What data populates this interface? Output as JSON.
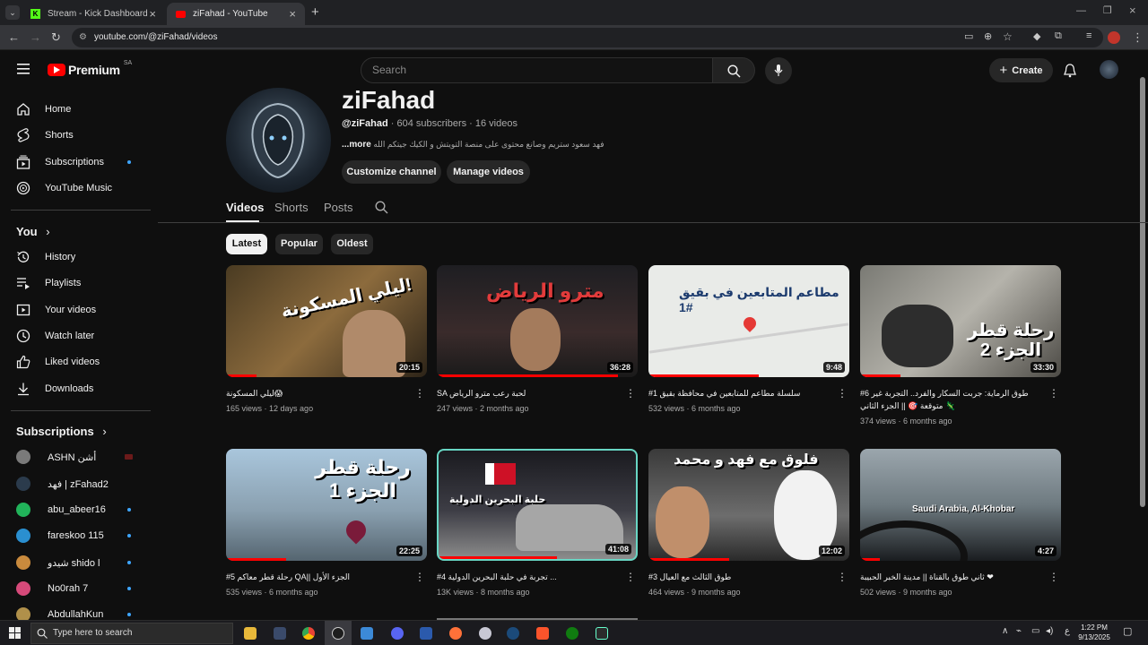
{
  "browser": {
    "tabs": [
      {
        "label": "Stream - Kick Dashboard"
      },
      {
        "label": "ziFahad - YouTube"
      }
    ],
    "url": "youtube.com/@ziFahad/videos"
  },
  "header": {
    "logo": "Premium",
    "region": "SA",
    "search_placeholder": "Search",
    "create_label": "Create"
  },
  "sidebar": {
    "main": [
      {
        "label": "Home"
      },
      {
        "label": "Shorts"
      },
      {
        "label": "Subscriptions"
      },
      {
        "label": "YouTube Music"
      }
    ],
    "you_title": "You",
    "you": [
      {
        "label": "History"
      },
      {
        "label": "Playlists"
      },
      {
        "label": "Your videos"
      },
      {
        "label": "Watch later"
      },
      {
        "label": "Liked videos"
      },
      {
        "label": "Downloads"
      }
    ],
    "subs_title": "Subscriptions",
    "subs": [
      {
        "label": "ASHN أشن",
        "color": "#7a7a7a"
      },
      {
        "label": "فهد | zFahad2",
        "color": "#2b3b4c"
      },
      {
        "label": "abu_abeer16",
        "color": "#21b35a"
      },
      {
        "label": "fareskoo 115",
        "color": "#2a8fd0"
      },
      {
        "label": "شيدو shido l",
        "color": "#c98a3d"
      },
      {
        "label": "No0rah 7",
        "color": "#d64a7a"
      },
      {
        "label": "AbdullahKun",
        "color": "#b0904a"
      }
    ]
  },
  "channel": {
    "name": "ziFahad",
    "handle": "@ziFahad",
    "meta": "· 604 subscribers · 16 videos",
    "description": "فهد سعود ستريم وصانع محتوى على منصة التويتش و الكيك جيتكم الله",
    "more": "...more",
    "customize": "Customize channel",
    "manage": "Manage videos",
    "tabs": [
      "Videos",
      "Shorts",
      "Posts"
    ],
    "chips": [
      "Latest",
      "Popular",
      "Oldest"
    ]
  },
  "videos": [
    {
      "title": "ليلي المسكونة😱",
      "views": "165 views",
      "age": "12 days ago",
      "duration": "20:15",
      "thumb_text": "ليلي المسكونة!",
      "progress": 0.15
    },
    {
      "title": "SA لحبة رعب مترو الرياض",
      "views": "247 views",
      "age": "2 months ago",
      "duration": "36:28",
      "thumb_text": "مترو الرياض",
      "progress": 0.9
    },
    {
      "title": "#1 سلسلة مطاعم للمتابعين في محافظة بقيق",
      "views": "532 views",
      "age": "6 months ago",
      "duration": "9:48",
      "thumb_text": "مطاعم المتابعين في بقيق #1",
      "progress": 0.55
    },
    {
      "title": "#6 طوق الرماية: جربت السكار والفرد.. التجربة غير متوقعة 🎯 || الجزء الثاني 🦎",
      "views": "374 views",
      "age": "6 months ago",
      "duration": "33:30",
      "thumb_text": "رحلة قطر الجزء 2",
      "progress": 0.2
    },
    {
      "title": "#5 رحلة قطر معاكم QA|| الجزء الأول",
      "views": "535 views",
      "age": "6 months ago",
      "duration": "22:25",
      "thumb_text": "رحلة قطر الجزء 1",
      "progress": 0.3
    },
    {
      "title": "#4 تجربة في حلبة البحرين الدولية ...",
      "views": "13K views",
      "age": "8 months ago",
      "duration": "41:08",
      "thumb_text": "حلبة البحرين الدولية",
      "progress": 0.6
    },
    {
      "title": "#3 طوق الثالث مع العيال",
      "views": "464 views",
      "age": "9 months ago",
      "duration": "12:02",
      "thumb_text": "فلوق مع فهد و محمد",
      "progress": 0.4
    },
    {
      "title": "ثاني طوق بالقناة || مدينة الخبر الحبيبة ❤",
      "views": "502 views",
      "age": "9 months ago",
      "duration": "4:27",
      "thumb_text": "Saudi Arabia, Al-Khobar",
      "progress": 0.1
    }
  ],
  "taskbar": {
    "search_placeholder": "Type here to search",
    "time": "1:22 PM",
    "date": "9/13/2025",
    "lang": "ع"
  }
}
